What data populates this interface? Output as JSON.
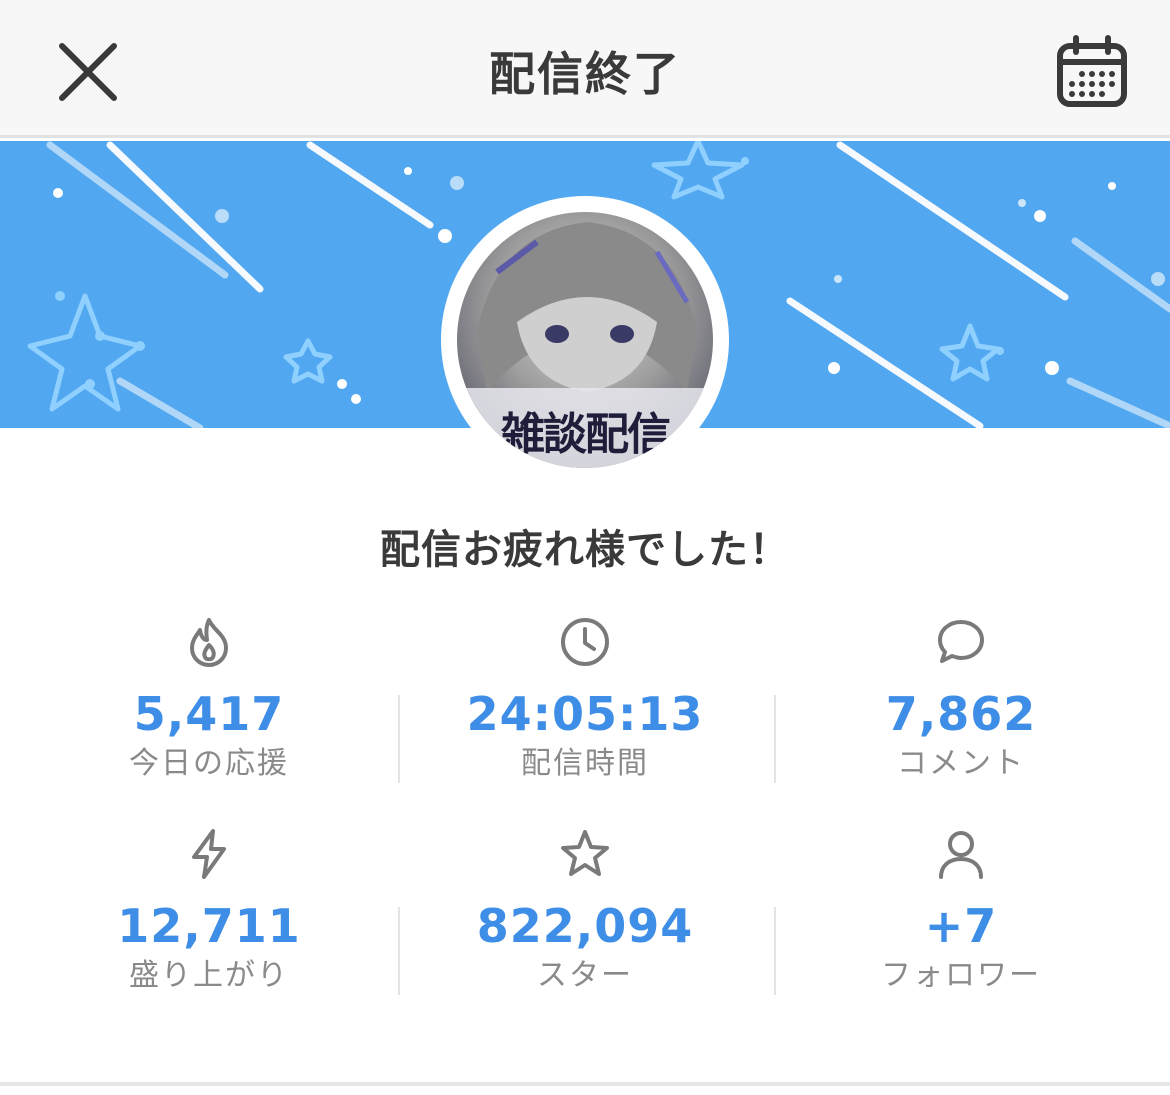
{
  "header": {
    "title": "配信終了",
    "close_icon": "close-icon",
    "calendar_icon": "calendar-icon"
  },
  "banner": {
    "background_color": "#52a8f0",
    "decoration": "stars-and-streaks"
  },
  "avatar": {
    "logo_text": "雑談配信"
  },
  "message": "配信お疲れ様でした！",
  "colors": {
    "accent": "#3e8de6",
    "label": "#8a8a8a",
    "text": "#3a3a3a"
  },
  "stats": [
    {
      "icon": "flame-icon",
      "value": "5,417",
      "label": "今日の応援"
    },
    {
      "icon": "clock-icon",
      "value": "24:05:13",
      "label": "配信時間"
    },
    {
      "icon": "comment-icon",
      "value": "7,862",
      "label": "コメント"
    },
    {
      "icon": "lightning-icon",
      "value": "12,711",
      "label": "盛り上がり"
    },
    {
      "icon": "star-icon",
      "value": "822,094",
      "label": "スター"
    },
    {
      "icon": "person-icon",
      "value": "+7",
      "label": "フォロワー"
    }
  ]
}
